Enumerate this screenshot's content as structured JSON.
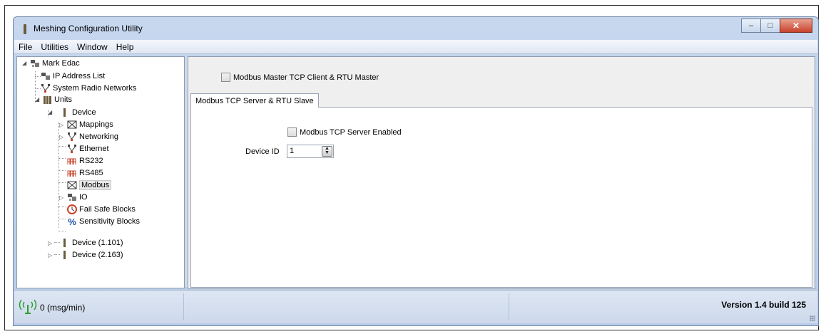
{
  "window": {
    "title": "Meshing Configuration Utility",
    "minimize": "–",
    "maximize": "□",
    "close": "✕"
  },
  "menu": [
    "File",
    "Utilities",
    "Window",
    "Help"
  ],
  "tree": {
    "root": "Mark Edac",
    "ip_list": "IP Address List",
    "radio_networks": "System Radio Networks",
    "units": "Units",
    "device": "Device",
    "children": [
      "Mappings",
      "Networking",
      "Ethernet",
      "RS232",
      "RS485",
      "Modbus",
      "IO",
      "Fail Safe Blocks",
      "Sensitivity Blocks"
    ],
    "device2": "Device (1.101)",
    "device3": "Device (2.163)"
  },
  "content": {
    "master_label": "Modbus Master TCP Client & RTU Master",
    "tab_label": "Modbus TCP Server & RTU Slave",
    "server_enabled_label": "Modbus TCP Server Enabled",
    "device_id_label": "Device ID",
    "device_id_value": "1"
  },
  "status": {
    "rate": "0 (msg/min)",
    "version": "Version 1.4 build 125"
  },
  "colors": {
    "accent": "#c8432d",
    "signal": "#2e9c2e"
  }
}
